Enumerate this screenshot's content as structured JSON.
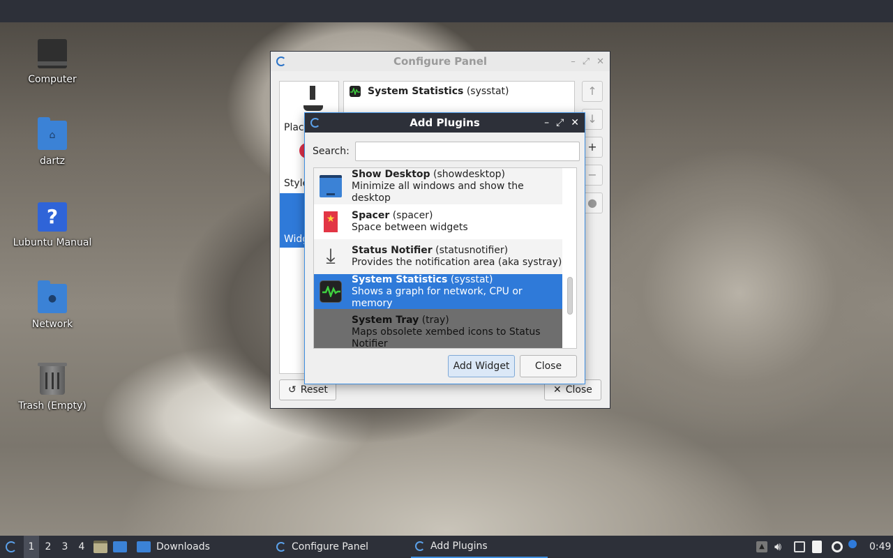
{
  "desktop": {
    "icons": [
      {
        "label": "Computer",
        "icon": "computer-icon"
      },
      {
        "label": "dartz",
        "icon": "home-folder-icon"
      },
      {
        "label": "Lubuntu Manual",
        "icon": "help-icon"
      },
      {
        "label": "Network",
        "icon": "network-folder-icon"
      },
      {
        "label": "Trash (Empty)",
        "icon": "trash-icon"
      }
    ]
  },
  "configure_panel": {
    "title": "Configure Panel",
    "sidebar": [
      {
        "label": "Places"
      },
      {
        "label": "Styles"
      },
      {
        "label": "Widgets"
      }
    ],
    "plugin_list": [
      {
        "name": "System Statistics",
        "id": "(sysstat)"
      }
    ],
    "reset_label": "Reset",
    "close_label": "Close"
  },
  "add_plugins": {
    "title": "Add Plugins",
    "search_label": "Search:",
    "search_value": "",
    "items": [
      {
        "name": "Show Desktop",
        "id": "(showdesktop)",
        "desc": "Minimize all windows and show the desktop"
      },
      {
        "name": "Spacer",
        "id": "(spacer)",
        "desc": "Space between widgets"
      },
      {
        "name": "Status Notifier",
        "id": "(statusnotifier)",
        "desc": "Provides the notification area (aka systray)"
      },
      {
        "name": "System Statistics",
        "id": "(sysstat)",
        "desc": "Shows a graph for network, CPU or memory"
      },
      {
        "name": "System Tray",
        "id": "(tray)",
        "desc": "Maps obsolete xembed icons to Status Notifier"
      }
    ],
    "selected_index": 3,
    "add_label": "Add Widget",
    "close_label": "Close"
  },
  "taskbar": {
    "desktops": [
      "1",
      "2",
      "3",
      "4"
    ],
    "active_desktop": "1",
    "tasks": [
      {
        "label": "Downloads",
        "icon": "folder-icon"
      },
      {
        "label": "Configure Panel",
        "icon": "lubuntu-logo-icon"
      },
      {
        "label": "Add Plugins",
        "icon": "lubuntu-logo-icon"
      }
    ],
    "clock": "0:49"
  },
  "colors": {
    "accent": "#2f7ad9",
    "panel": "#2d3039"
  }
}
